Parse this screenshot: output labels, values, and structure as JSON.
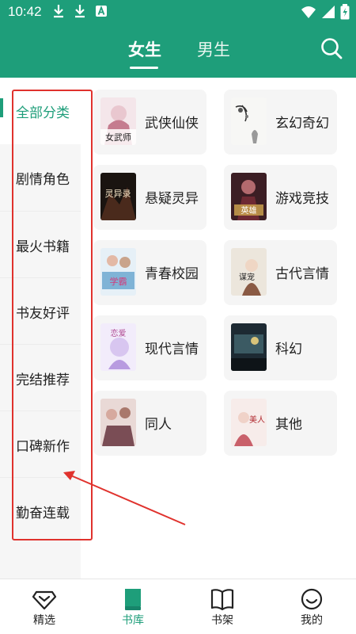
{
  "status_bar": {
    "time": "10:42",
    "icons": [
      "download-icon",
      "download-icon",
      "a-badge-icon",
      "wifi-icon",
      "signal-icon",
      "battery-icon"
    ]
  },
  "header": {
    "tabs": [
      {
        "label": "女生",
        "active": true
      },
      {
        "label": "男生",
        "active": false
      }
    ],
    "search_icon": "search-icon",
    "color": "#1e9e7a"
  },
  "sidebar": {
    "items": [
      {
        "label": "全部分类",
        "active": true
      },
      {
        "label": "剧情角色",
        "active": false
      },
      {
        "label": "最火书籍",
        "active": false
      },
      {
        "label": "书友好评",
        "active": false
      },
      {
        "label": "完结推荐",
        "active": false
      },
      {
        "label": "口碑新作",
        "active": false
      },
      {
        "label": "勤奋连载",
        "active": false
      }
    ]
  },
  "categories": [
    {
      "label": "武侠仙侠",
      "cover_text": "女武师"
    },
    {
      "label": "玄幻奇幻",
      "cover_text": ""
    },
    {
      "label": "悬疑灵异",
      "cover_text": "灵异录"
    },
    {
      "label": "游戏竞技",
      "cover_text": "英雄"
    },
    {
      "label": "青春校园",
      "cover_text": "学霸"
    },
    {
      "label": "古代言情",
      "cover_text": "谋宠"
    },
    {
      "label": "现代言情",
      "cover_text": "恋爱"
    },
    {
      "label": "科幻",
      "cover_text": ""
    },
    {
      "label": "同人",
      "cover_text": ""
    },
    {
      "label": "其他",
      "cover_text": "美人"
    }
  ],
  "bottom_nav": [
    {
      "label": "精选",
      "icon": "diamond-icon",
      "active": false
    },
    {
      "label": "书库",
      "icon": "book-icon",
      "active": true
    },
    {
      "label": "书架",
      "icon": "open-book-icon",
      "active": false
    },
    {
      "label": "我的",
      "icon": "smiley-icon",
      "active": false
    }
  ],
  "colors": {
    "accent": "#1e9e7a",
    "annotation": "#e0322d"
  }
}
